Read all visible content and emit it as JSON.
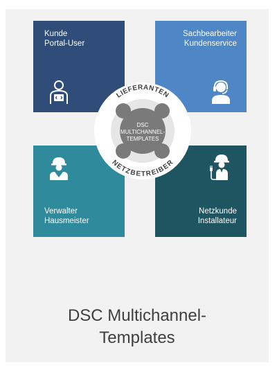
{
  "tiles": {
    "top_left": {
      "line1": "Kunde",
      "line2": "Portal-User",
      "color": "#2f4d78",
      "icon": "developer-laptop-icon"
    },
    "top_right": {
      "line1": "Sachbearbeiter",
      "line2": "Kundenservice",
      "color": "#4f86c5",
      "icon": "headset-agent-icon"
    },
    "bottom_left": {
      "line1": "Verwalter",
      "line2": "Hausmeister",
      "color": "#2f8a9c",
      "icon": "worker-helmet-icon"
    },
    "bottom_right": {
      "line1": "Netzkunde",
      "line2": "Installateur",
      "color": "#1f5560",
      "icon": "electrician-plug-icon"
    }
  },
  "ring": {
    "top_text": "LIEFERANTEN",
    "bottom_text": "NETZBETREIBER"
  },
  "hub": {
    "line1": "DSC",
    "line2": "MULTICHANNEL-",
    "line3": "TEMPLATES"
  },
  "caption": {
    "line1": "DSC Multichannel-",
    "line2": "Templates"
  }
}
